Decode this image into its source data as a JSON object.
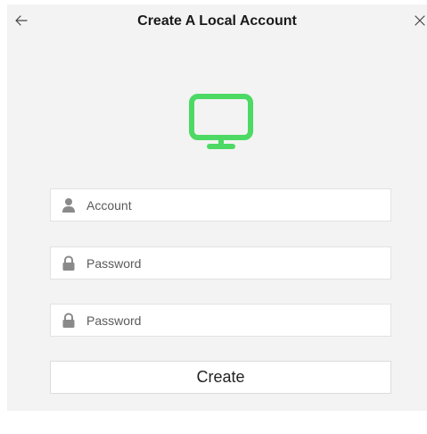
{
  "window": {
    "title": "Create A Local Account"
  },
  "icons": {
    "back": "arrow-left-icon",
    "close": "close-icon",
    "computer": "monitor-icon",
    "user": "user-icon",
    "lock": "lock-icon"
  },
  "colors": {
    "accent": "#4cd964",
    "background": "#f3f3f3"
  },
  "form": {
    "account_placeholder": "Account",
    "password_placeholder": "Password",
    "confirm_password_placeholder": "Password",
    "create_label": "Create"
  }
}
